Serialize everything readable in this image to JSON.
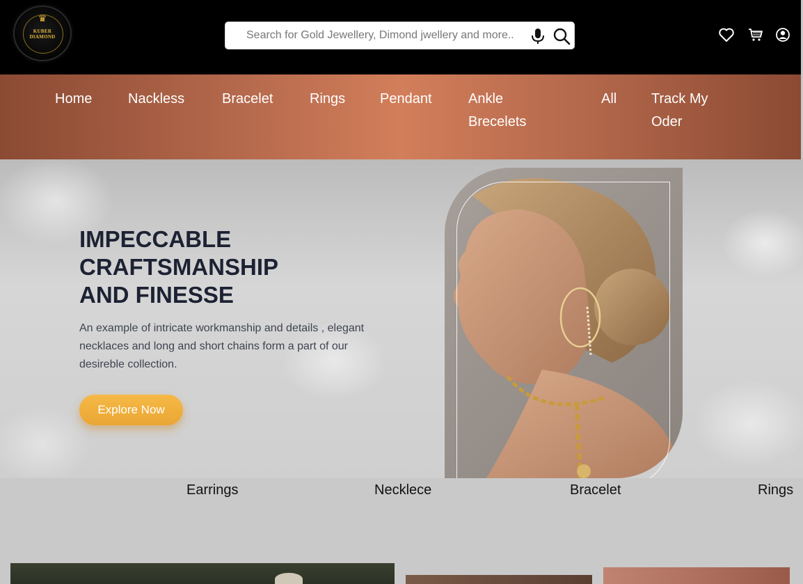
{
  "header": {
    "logo": {
      "brand_line1": "KUBER",
      "brand_line2": "DIAMOND"
    },
    "search": {
      "placeholder": "Search for Gold Jewellery, Dimond jwellery and more.."
    },
    "icons": [
      "microphone-icon",
      "search-icon",
      "heart-icon",
      "cart-icon",
      "account-icon"
    ]
  },
  "nav": {
    "items": [
      {
        "label": "Home"
      },
      {
        "label": "Nackless"
      },
      {
        "label": "Bracelet"
      },
      {
        "label": "Rings"
      },
      {
        "label": "Pendant"
      },
      {
        "label_line1": "Ankle",
        "label_line2": "Brecelets"
      },
      {
        "label": "All"
      },
      {
        "label_line1": "Track My",
        "label_line2": "Oder"
      }
    ]
  },
  "hero": {
    "title_line1": "IMPECCABLE",
    "title_line2": "CRAFTSMANSHIP",
    "title_line3": "AND FINESSE",
    "description": "An example of intricate workmanship and details , elegant necklaces and long and short chains form a part of our desireble collection.",
    "cta_label": "Explore Now"
  },
  "categories": {
    "items": [
      "Earrings",
      "Necklece",
      "Bracelet",
      "Rings"
    ]
  },
  "colors": {
    "header_bg": "#000000",
    "nav_gradient_edge": "#8b4a33",
    "nav_gradient_center": "#d27e5a",
    "cta_button": "#f0b03e",
    "hero_title": "#1c2233",
    "logo_gold": "#e5b93a"
  }
}
